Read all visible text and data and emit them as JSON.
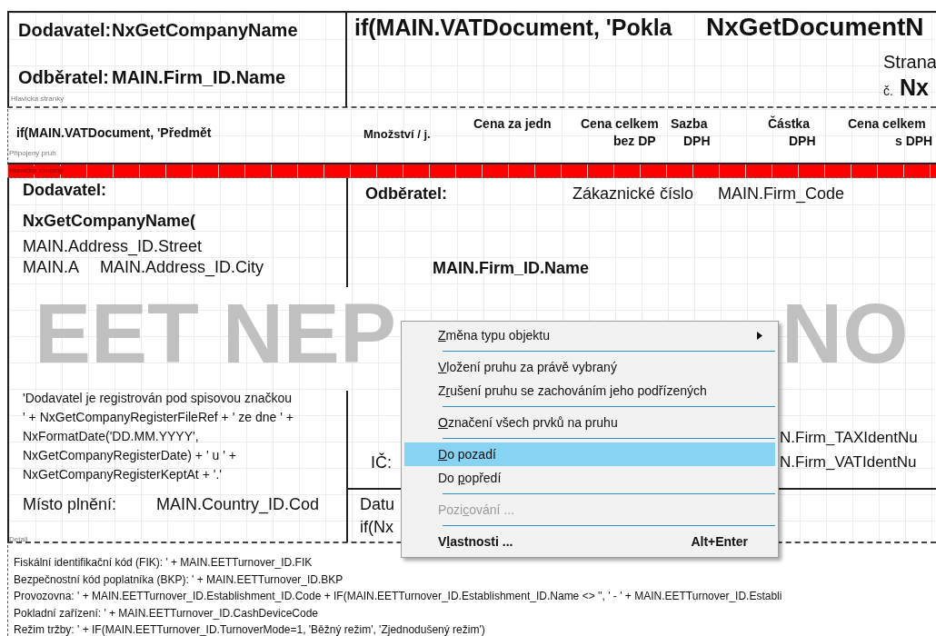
{
  "page_header": {
    "band_label": "Hlavicka stranky",
    "fields": [
      {
        "text": "Dodavatel:",
        "bold": true
      },
      {
        "text": "NxGetCompanyName",
        "bold": true
      },
      {
        "text": "Odběratel:",
        "bold": true
      },
      {
        "text": "MAIN.Firm_ID.Name",
        "bold": true
      },
      {
        "text": "if(MAIN.VATDocument, 'Pokla",
        "bold": true
      },
      {
        "text": "NxGetDocumentN",
        "bold": true
      },
      {
        "text": "Strana",
        "bold": false
      },
      {
        "text": "č.",
        "bold": false
      },
      {
        "text": "Nx",
        "bold": true
      }
    ]
  },
  "attached_band": {
    "band_label": "Připojený pruh",
    "fields": [
      {
        "text": "if(MAIN.VATDocument, 'Předmět",
        "bold": true
      },
      {
        "text": "Množství / j.",
        "bold": true
      },
      {
        "text": "Cena za jedn",
        "bold": true
      },
      {
        "text": "Cena celkem",
        "bold": true
      },
      {
        "text": "bez DP",
        "bold": true
      },
      {
        "text": "Sazba",
        "bold": true
      },
      {
        "text": "DPH",
        "bold": true
      },
      {
        "text": "Částka",
        "bold": true
      },
      {
        "text": "DPH",
        "bold": true
      },
      {
        "text": "Cena celkem",
        "bold": true
      },
      {
        "text": "s DPH",
        "bold": true
      }
    ]
  },
  "group_header": {
    "band_label": "Hlavička skupiny"
  },
  "detail": {
    "band_label": "Detail",
    "watermark_parts": [
      "EET NEP",
      "NO"
    ],
    "paragraph": "'Dodavatel je registrován pod spisovou značkou ' + NxGetCompanyRegisterFileRef + ' ze dne ' + NxFormatDate('DD.MM.YYYY', NxGetCompanyRegisterDate) + ' u ' + NxGetCompanyRegisterKeptAt + '.'",
    "fields": [
      {
        "text": "Dodavatel:",
        "bold": true
      },
      {
        "text": "NxGetCompanyName(",
        "bold": true
      },
      {
        "text": "MAIN.Address_ID.Street",
        "bold": false
      },
      {
        "text": "MAIN.A",
        "bold": false
      },
      {
        "text": "MAIN.Address_ID.City",
        "bold": false
      },
      {
        "text": "Odběratel:",
        "bold": true
      },
      {
        "text": "Zákaznické číslo",
        "bold": false
      },
      {
        "text": "MAIN.Firm_Code",
        "bold": false
      },
      {
        "text": "MAIN.Firm_ID.Name",
        "bold": true
      },
      {
        "text": "IČ:",
        "bold": false
      },
      {
        "text": "N.Firm_TAXIdentNu",
        "bold": false
      },
      {
        "text": "N.Firm_VATIdentNu",
        "bold": false
      },
      {
        "text": "Místo plnění:",
        "bold": false
      },
      {
        "text": "MAIN.Country_ID.Cod",
        "bold": false
      },
      {
        "text": "Datu",
        "bold": false
      },
      {
        "text": "if(Nx",
        "bold": false
      }
    ]
  },
  "footer": {
    "lines": [
      "Fiskální identifikační kód (FIK): ' + MAIN.EETTurnover_ID.FIK",
      "Bezpečnostní kód poplatníka (BKP): ' + MAIN.EETTurnover_ID.BKP",
      "Provozovna: ' + MAIN.EETTurnover_ID.Establishment_ID.Code + IF(MAIN.EETTurnover_ID.Establishment_ID.Name <> '',  ' - ' + MAIN.EETTurnover_ID.Establi",
      "Pokladní zařízení: ' + MAIN.EETTurnover_ID.CashDeviceCode",
      "Režim tržby: ' + IF(MAIN.EETTurnover_ID.TurnoverMode=1, 'Běžný režim', 'Zjednodušený režim')"
    ]
  },
  "context_menu": {
    "items": [
      {
        "kind": "item",
        "access_key": "Z",
        "label_after": "měna typu objektu",
        "submenu": true,
        "selected": false,
        "disabled": false,
        "bold": false
      },
      {
        "kind": "separator"
      },
      {
        "kind": "item",
        "access_key": "V",
        "label_after": "ložení pruhu za právě vybraný",
        "submenu": false,
        "selected": false,
        "disabled": false,
        "bold": false
      },
      {
        "kind": "item",
        "label_before": "Z",
        "access_key": "r",
        "label_after": "ušení pruhu se zachováním jeho podřízených",
        "submenu": false,
        "selected": false,
        "disabled": false,
        "bold": false
      },
      {
        "kind": "separator"
      },
      {
        "kind": "item",
        "access_key": "O",
        "label_after": "značení všech prvků na pruhu",
        "submenu": false,
        "selected": false,
        "disabled": false,
        "bold": false
      },
      {
        "kind": "separator"
      },
      {
        "kind": "item",
        "access_key": "D",
        "label_after": "o pozadí",
        "submenu": false,
        "selected": true,
        "disabled": false,
        "bold": false
      },
      {
        "kind": "item",
        "label_before": "Do ",
        "access_key": "p",
        "label_after": "opředí",
        "submenu": false,
        "selected": false,
        "disabled": false,
        "bold": false
      },
      {
        "kind": "separator"
      },
      {
        "kind": "item",
        "label_before": "Pozi",
        "access_key": "c",
        "label_after": "ování ...",
        "submenu": false,
        "selected": false,
        "disabled": true,
        "bold": false
      },
      {
        "kind": "separator"
      },
      {
        "kind": "item",
        "label_before": "V",
        "access_key": "l",
        "label_after": "astnosti ...",
        "shortcut": "Alt+Enter",
        "submenu": false,
        "selected": false,
        "disabled": false,
        "bold": true
      }
    ]
  }
}
